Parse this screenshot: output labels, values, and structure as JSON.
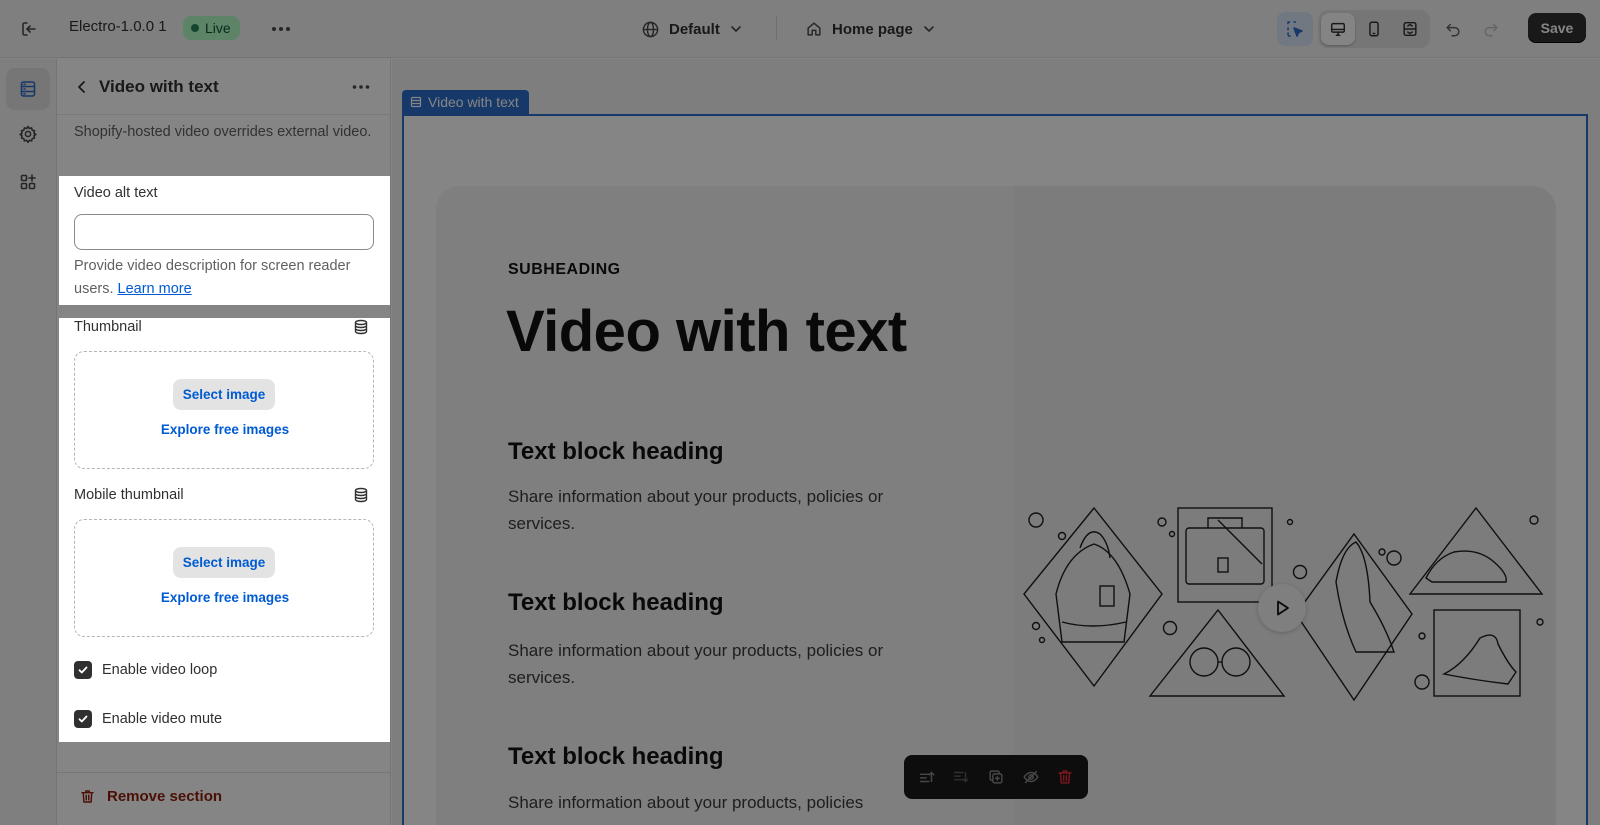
{
  "topbar": {
    "theme_name": "Electro-1.0.0 1",
    "live_badge": "Live",
    "template": "Default",
    "page": "Home page",
    "save_label": "Save"
  },
  "panel": {
    "title": "Video with text",
    "note": "Shopify-hosted video overrides external video.",
    "alt_text_label": "Video alt text",
    "alt_text_value": "",
    "alt_text_help": "Provide video description for screen reader users.",
    "learn_more": "Learn more",
    "thumbnail_label": "Thumbnail",
    "mobile_thumbnail_label": "Mobile thumbnail",
    "select_image": "Select image",
    "explore_free_images": "Explore free images",
    "loop_label": "Enable video loop",
    "loop_checked": true,
    "mute_label": "Enable video mute",
    "mute_checked": true,
    "remove_section": "Remove section"
  },
  "preview": {
    "section_tag": "Video with text",
    "subheading": "SUBHEADING",
    "title": "Video with text",
    "blocks": [
      {
        "heading": "Text block heading",
        "body": "Share information about your products, policies or services."
      },
      {
        "heading": "Text block heading",
        "body": "Share information about your products, policies or services."
      },
      {
        "heading": "Text block heading",
        "body": "Share information about your products, policies"
      }
    ]
  },
  "colors": {
    "accent": "#2c6ecb",
    "link": "#005bd3",
    "live_badge_bg": "#b4fec8",
    "critical": "#8e1f0b",
    "primary_button": "#303030"
  },
  "icons": {
    "exit": "exit-icon",
    "more": "more-horizontal-icon",
    "globe": "globe-icon",
    "home": "home-icon",
    "inspector": "cursor-select-icon",
    "desktop": "desktop-icon",
    "mobile": "mobile-icon",
    "fullwidth": "full-width-icon",
    "undo": "undo-icon",
    "redo": "redo-icon",
    "sections": "sections-icon",
    "settings": "gear-icon",
    "apps": "apps-icon",
    "database": "database-icon",
    "trash": "trash-icon",
    "play": "play-icon"
  }
}
